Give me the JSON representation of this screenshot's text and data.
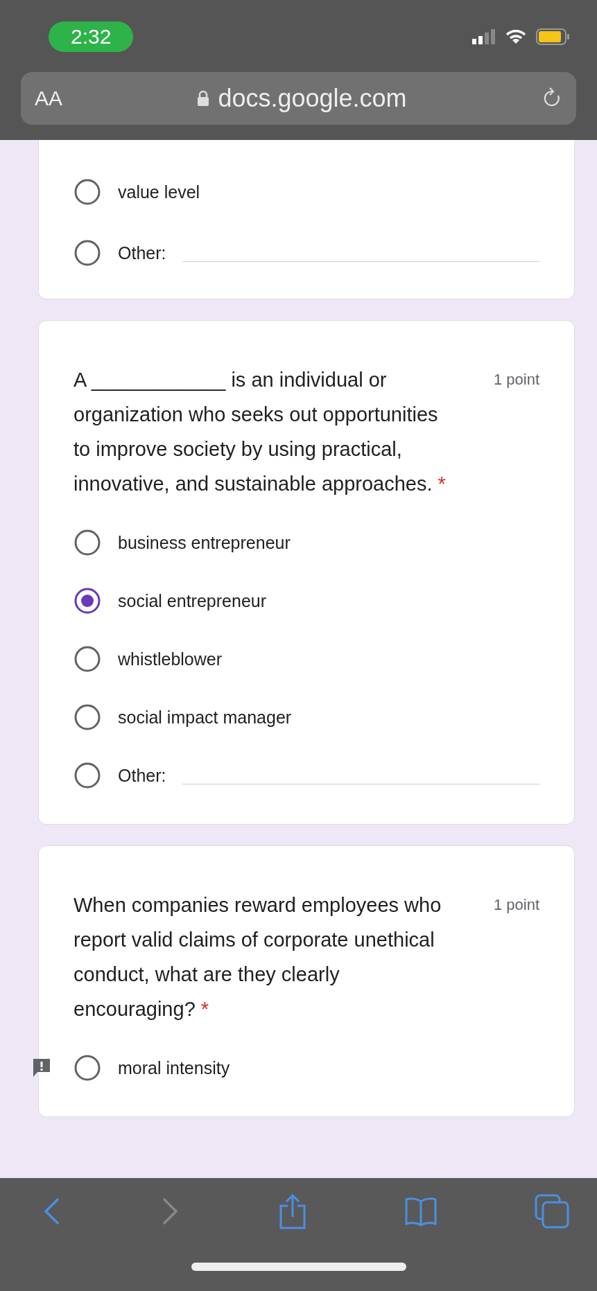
{
  "status_bar": {
    "time": "2:32"
  },
  "address_bar": {
    "text_size": "AA",
    "url": "docs.google.com"
  },
  "questions": [
    {
      "options": [
        {
          "label": "value level",
          "kind": "plain",
          "selected": false
        },
        {
          "label": "Other:",
          "kind": "other",
          "selected": false
        }
      ]
    },
    {
      "text": "A ____________ is an individual or organization who seeks out opportunities to improve society by using practical, innovative, and sustainable approaches.",
      "required_mark": "*",
      "points": "1 point",
      "options": [
        {
          "label": "business entrepreneur",
          "kind": "plain",
          "selected": false
        },
        {
          "label": "social entrepreneur",
          "kind": "plain",
          "selected": true
        },
        {
          "label": "whistleblower",
          "kind": "plain",
          "selected": false
        },
        {
          "label": "social impact manager",
          "kind": "plain",
          "selected": false
        },
        {
          "label": "Other:",
          "kind": "other",
          "selected": false
        }
      ]
    },
    {
      "text": "When companies reward employees who report valid claims of corporate unethical conduct, what are they clearly encouraging?",
      "required_mark": "*",
      "points": "1 point",
      "feedback": true,
      "options": [
        {
          "label": "moral intensity",
          "kind": "plain",
          "selected": false
        }
      ]
    }
  ]
}
